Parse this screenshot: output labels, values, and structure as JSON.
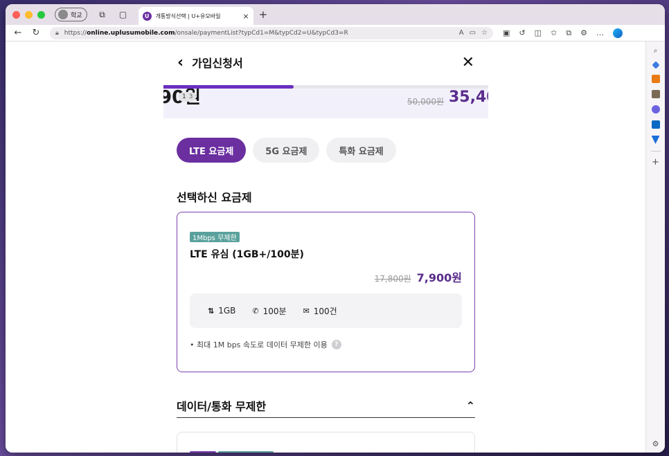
{
  "browser": {
    "profile_label": "학교",
    "tab_title": "개통방식선택 | U+유모바일",
    "tab_favicon": "U",
    "url_prefix": "https://",
    "url_domain": "online.uplusumobile.com",
    "url_path": "/onsale/paymentList?typCd1=M&typCd2=U&typCd3=R"
  },
  "header": {
    "title": "가입신청서"
  },
  "progress": {
    "fraction": 0.4
  },
  "banner": {
    "left_price": "90원",
    "counter_current": "1",
    "counter_total": "3",
    "original_price": "50,000원",
    "sale_price": "35,40"
  },
  "tabs": [
    {
      "label": "LTE 요금제",
      "active": true
    },
    {
      "label": "5G 요금제",
      "active": false
    },
    {
      "label": "특화 요금제",
      "active": false
    }
  ],
  "selected_section": {
    "title": "선택하신 요금제",
    "plan": {
      "badge": "1Mbps 무제한",
      "name": "LTE 유심 (1GB+/100분)",
      "original_price": "17,800원",
      "sale_price": "7,900원",
      "features": {
        "data": "1GB",
        "voice": "100분",
        "sms": "100건"
      },
      "note": "• 최대 1M bps 속도로 데이터 무제한 이용"
    }
  },
  "accordion": {
    "title": "데이터/통화 무제한"
  },
  "colors": {
    "accent": "#6b2fa0",
    "badge": "#5aa19d",
    "price": "#5a2d8c"
  }
}
